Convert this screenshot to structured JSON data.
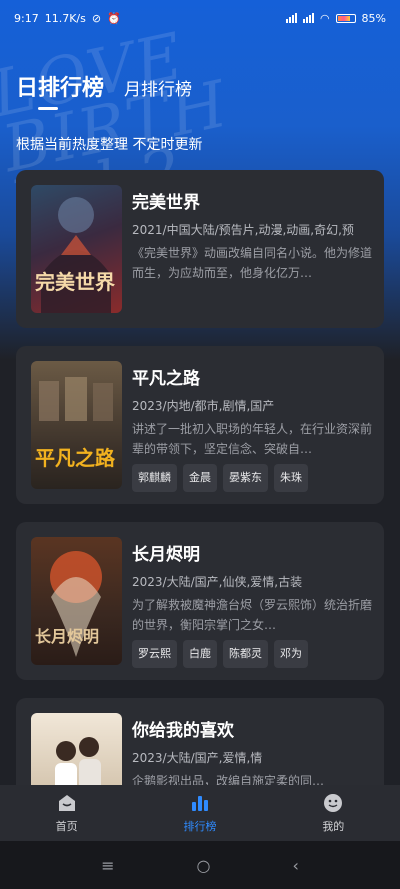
{
  "status_bar": {
    "time": "9:17",
    "net_speed": "11.7K/s",
    "battery": "85%"
  },
  "header": {
    "watermark_text": "LOVE BIRTH Vol.2",
    "tabs": [
      {
        "label": "日排行榜",
        "active": true
      },
      {
        "label": "月排行榜",
        "active": false
      }
    ],
    "subtitle": "根据当前热度整理 不定时更新"
  },
  "cards": [
    {
      "title": "完美世界",
      "meta": "2021/中国大陆/预告片,动漫,动画,奇幻,预",
      "desc": "《完美世界》动画改编自同名小说。他为修道而生，为应劫而至，他身化亿万…",
      "actors": [],
      "poster_text": "完美世界",
      "poster_colors": [
        "#1d2a3a",
        "#3a2a40",
        "#b3412f"
      ]
    },
    {
      "title": "平凡之路",
      "meta": "2023/内地/都市,剧情,国产",
      "desc": "讲述了一批初入职场的年轻人，在行业资深前辈的带领下，坚定信念、突破自…",
      "actors": [
        "郭麒麟",
        "金晨",
        "晏紫东",
        "朱珠"
      ],
      "poster_text": "平凡之路",
      "poster_colors": [
        "#5a4a38",
        "#3b3129",
        "#f2b21f"
      ]
    },
    {
      "title": "长月烬明",
      "meta": "2023/大陆/国产,仙侠,爱情,古装",
      "desc": "为了解救被魔神澹台烬（罗云熙饰）统治折磨的世界，衡阳宗掌门之女…",
      "actors": [
        "罗云熙",
        "白鹿",
        "陈都灵",
        "邓为"
      ],
      "poster_text": "长月烬明",
      "poster_colors": [
        "#3a2820",
        "#6a3a22",
        "#d2542c"
      ]
    },
    {
      "title": "你给我的喜欢",
      "meta": "2023/大陆/国产,爱情,情",
      "desc": "企鹅影视出品，改编自施定柔的同…",
      "actors": [],
      "poster_text": "",
      "poster_colors": [
        "#d7c8b2",
        "#c08a5a",
        "#f1e7d8"
      ]
    }
  ],
  "bottom_nav": [
    {
      "label": "首页",
      "icon": "home-icon",
      "active": false
    },
    {
      "label": "排行榜",
      "icon": "ranking-icon",
      "active": true
    },
    {
      "label": "我的",
      "icon": "profile-icon",
      "active": false
    }
  ],
  "system_nav": {
    "menu": "≡",
    "home": "○",
    "back": "‹"
  },
  "colors": {
    "accent": "#2f8bff",
    "card_bg": "#2b2d33",
    "page_bg": "#1f2127"
  }
}
